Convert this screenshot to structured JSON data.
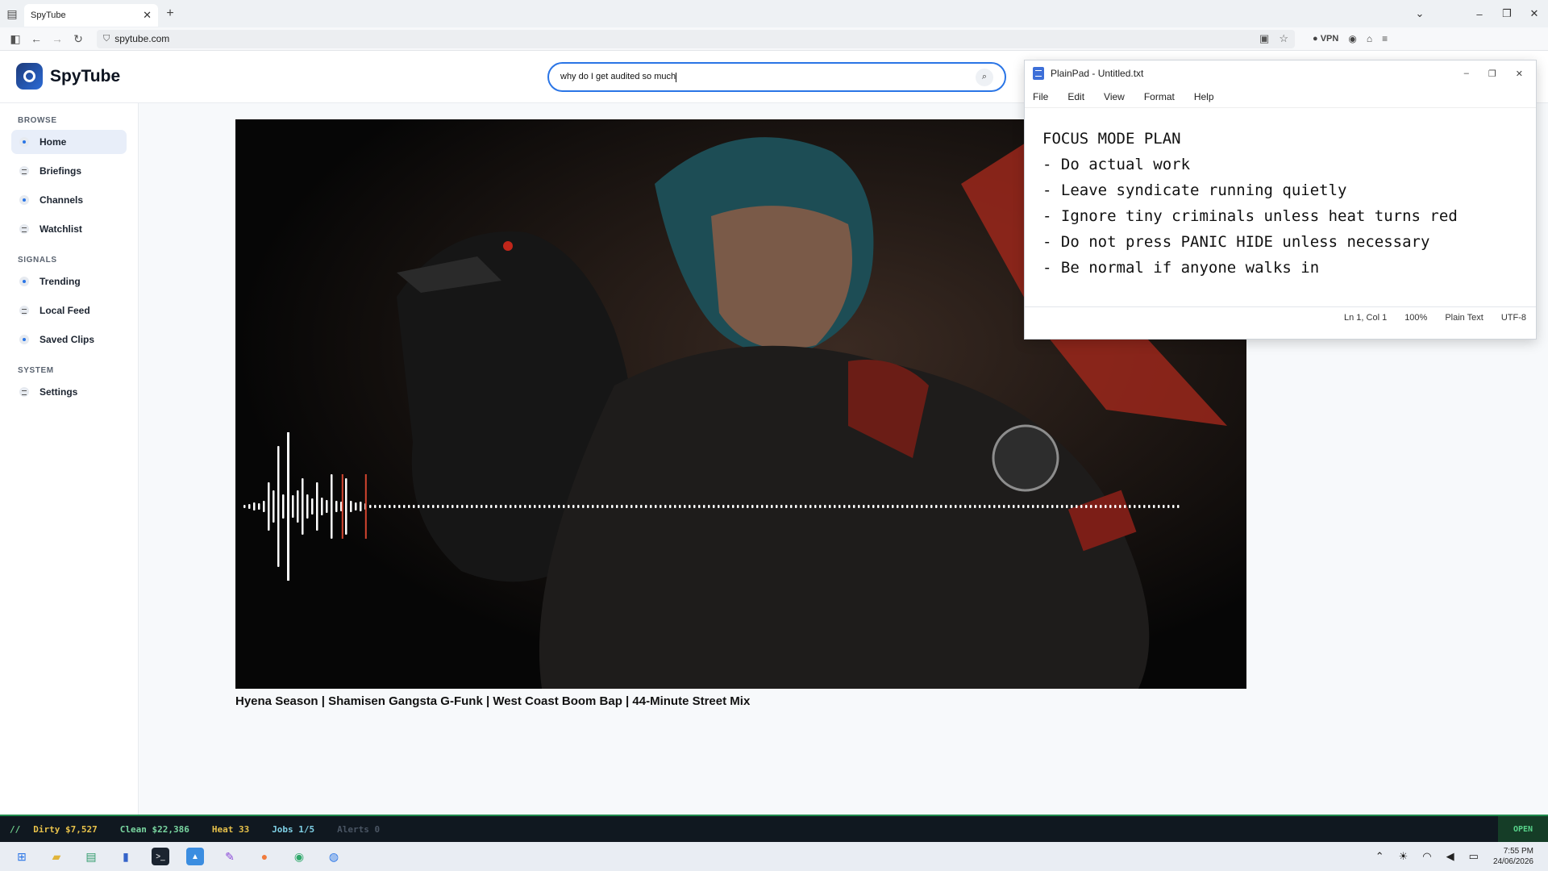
{
  "browser": {
    "tab_title": "SpyTube",
    "tab_close": "✕",
    "new_tab": "+",
    "url": "spytube.com",
    "vpn_label": "VPN"
  },
  "app": {
    "name": "SpyTube",
    "search_value": "why do I get audited so much"
  },
  "sidebar": {
    "sections": [
      {
        "title": "BROWSE",
        "items": [
          "Home",
          "Briefings",
          "Channels",
          "Watchlist"
        ]
      },
      {
        "title": "SIGNALS",
        "items": [
          "Trending",
          "Local Feed",
          "Saved Clips"
        ]
      },
      {
        "title": "SYSTEM",
        "items": [
          "Settings"
        ]
      }
    ],
    "active_item": "Home"
  },
  "video": {
    "title": "Hyena Season | Shamisen Gangsta G-Funk | West Coast Boom Bap | 44-Minute Street Mix",
    "progress": 0.15
  },
  "notepad": {
    "window_title": "PlainPad - Untitled.txt",
    "menu": [
      "File",
      "Edit",
      "View",
      "Format",
      "Help"
    ],
    "lines": [
      "FOCUS MODE PLAN",
      "- Do actual work",
      "- Leave syndicate running quietly",
      "- Ignore tiny criminals unless heat turns red",
      "- Do not press PANIC HIDE unless necessary",
      "- Be normal if anyone walks in"
    ],
    "status": {
      "position": "Ln 1, Col 1",
      "zoom": "100%",
      "mode": "Plain Text",
      "encoding": "UTF-8"
    }
  },
  "gamebar": {
    "prefix": "//",
    "dirty": "Dirty $7,527",
    "clean": "Clean $22,386",
    "heat": "Heat 33",
    "jobs": "Jobs 1/5",
    "alerts": "Alerts 0",
    "button": "OPEN"
  },
  "taskbar": {
    "time": "7:55 PM",
    "date": "24/06/2026"
  },
  "colors": {
    "accent": "#2a75e6",
    "gamebar_bg": "#101820",
    "dirty": "#e7c14a",
    "clean": "#79d6a0"
  }
}
